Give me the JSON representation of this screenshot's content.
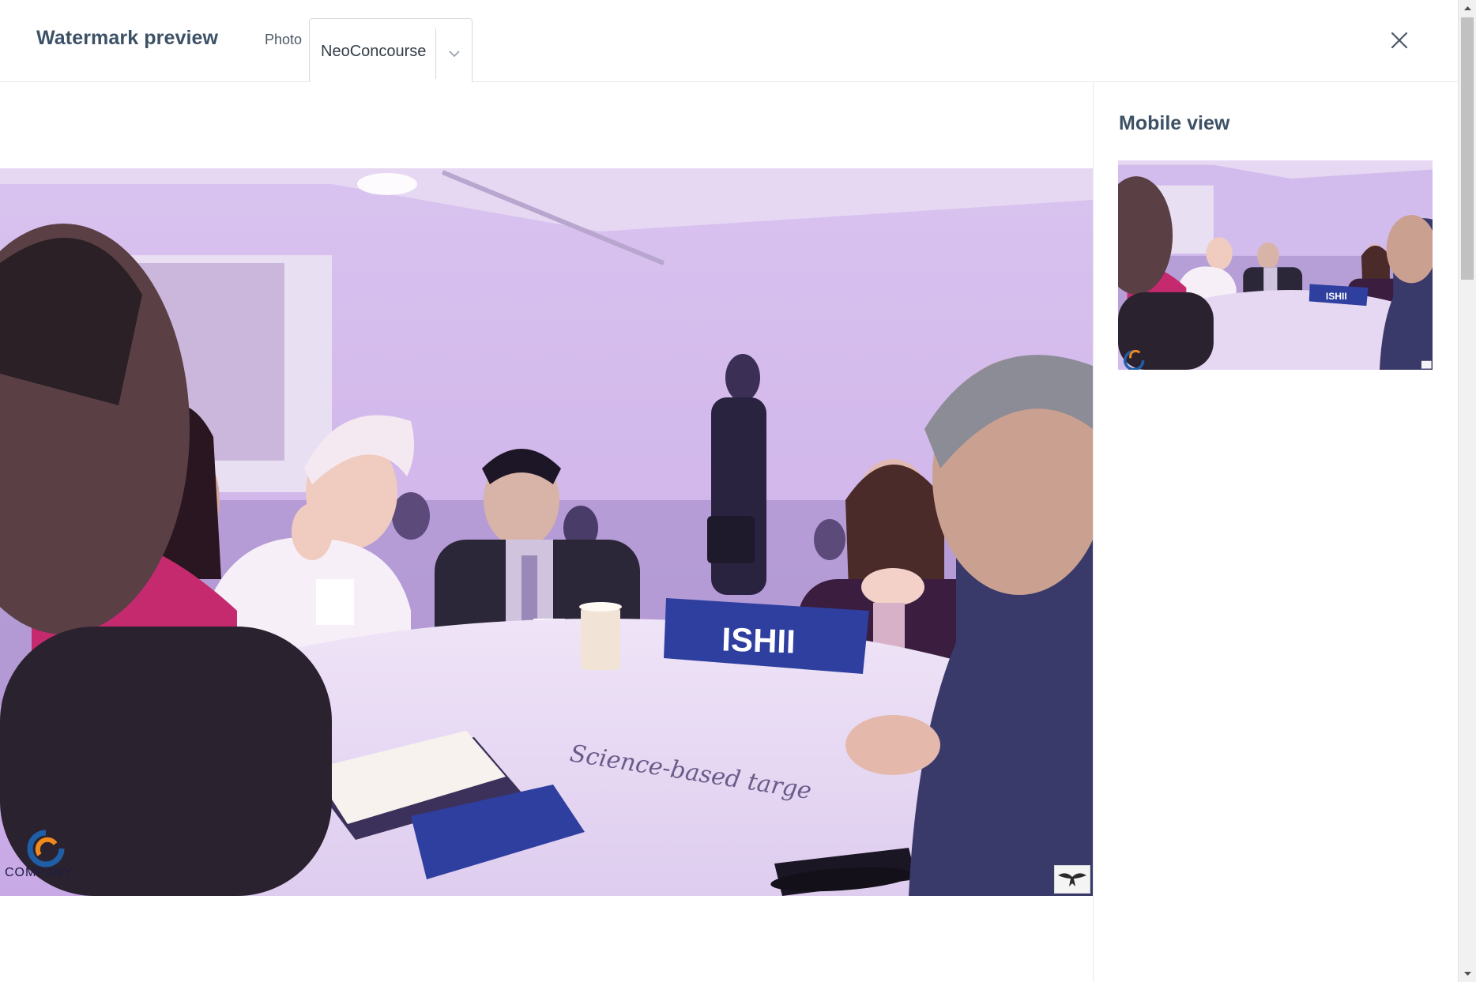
{
  "header": {
    "title": "Watermark preview",
    "photo_label": "Photo",
    "photo_select": {
      "value": "NeoConcourse"
    },
    "close_icon": "close-icon"
  },
  "preview": {
    "placard_text": "ISHII",
    "logo_text": "COMPANY",
    "table_writing": "Science-based targe"
  },
  "mobile": {
    "title": "Mobile view"
  },
  "icons": {
    "chevron": "chevron-down-icon",
    "close": "close-icon",
    "logo": "company-logo",
    "watermark": "eagle-watermark-icon"
  },
  "colors": {
    "title": "#3d5166",
    "placard": "#2f3f9f",
    "logo_orange": "#f08a1c",
    "logo_blue": "#1f5fa8"
  }
}
